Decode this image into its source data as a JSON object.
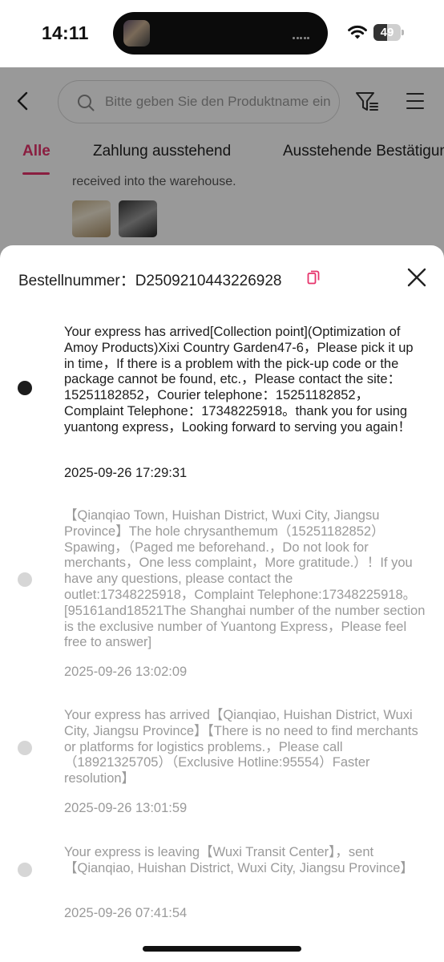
{
  "status_bar": {
    "time": "14:11",
    "battery": "49",
    "battery_level": 0.49
  },
  "nav": {
    "search_placeholder": "Bitte geben Sie den Produktname ein"
  },
  "tabs": [
    {
      "label": "Alle",
      "active": true
    },
    {
      "label": "Zahlung ausstehend",
      "active": false
    },
    {
      "label": "Ausstehende Bestätigung",
      "active": false
    }
  ],
  "order_card": {
    "text": "received into the warehouse."
  },
  "sheet": {
    "order_label": "Bestellnummer：D2509210443226928",
    "accent": "#e6336b"
  },
  "events": [
    {
      "description": "Your express has arrived[Collection point](Optimization of Amoy Products)Xixi Country Garden47-6，Please pick it up in time，If there is a problem with the pick-up code or the package cannot be found, etc.，Please contact the site：15251182852，Courier telephone：15251182852，Complaint Telephone：17348225918。thank you for using yuantong express，Looking forward to serving you again！",
      "time": "2025-09-26 17:29:31",
      "current": true
    },
    {
      "description": "【Qianqiao Town, Huishan District, Wuxi City, Jiangsu Province】The hole chrysanthemum（15251182852）Spawing，（Paged me beforehand.，Do not look for merchants，One less complaint，More gratitude.）！If you have any questions, please contact the outlet:17348225918，Complaint Telephone:17348225918。[95161and18521The Shanghai number of the number section is the exclusive number of Yuantong Express，Please feel free to answer]",
      "time": "2025-09-26 13:02:09",
      "current": false
    },
    {
      "description": "Your express has arrived【Qianqiao, Huishan District, Wuxi City, Jiangsu Province】【There is no need to find merchants or platforms for logistics problems.，Please call（18921325705）（Exclusive Hotline:95554）Faster resolution】",
      "time": "2025-09-26 13:01:59",
      "current": false
    },
    {
      "description": "Your express is leaving【Wuxi Transit Center】，sent【Qianqiao, Huishan District, Wuxi City, Jiangsu Province】",
      "time": "2025-09-26 07:41:54",
      "current": false
    }
  ]
}
